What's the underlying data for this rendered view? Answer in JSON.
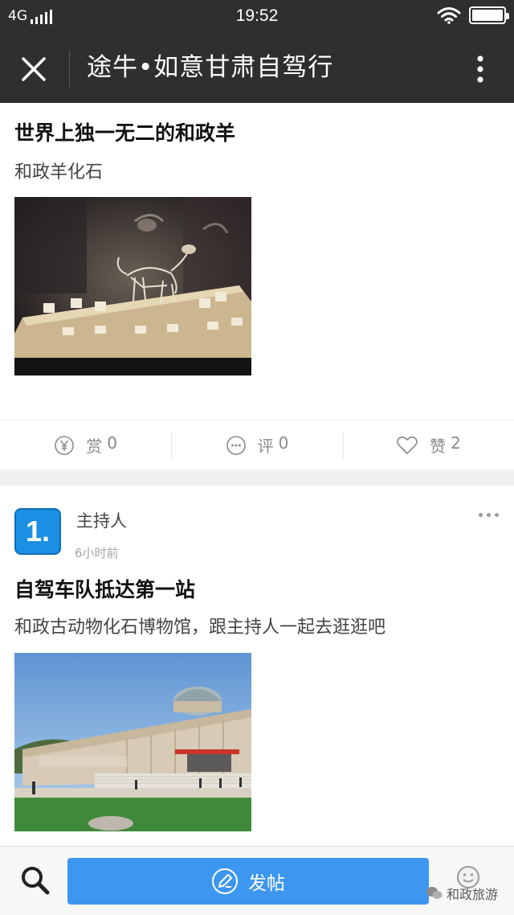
{
  "status_bar": {
    "network": "4G",
    "time": "19:52",
    "battery_level": 1.0
  },
  "nav": {
    "title": "途牛•如意甘肃自驾行",
    "close_icon": "close-icon",
    "more_icon": "more-vertical-icon"
  },
  "posts": [
    {
      "title": "世界上独一无二的和政羊",
      "description": "和政羊化石",
      "image": "fossil-sheep-skeleton-photo",
      "actions": {
        "reward": {
          "label": "赏",
          "count": "0"
        },
        "comment": {
          "label": "评",
          "count": "0"
        },
        "like": {
          "label": "赞",
          "count": "2"
        }
      }
    },
    {
      "author": "主持人",
      "avatar_text": "1.",
      "time": "6小时前",
      "title": "自驾车队抵达第一站",
      "description": "和政古动物化石博物馆，跟主持人一起去逛逛吧",
      "image": "museum-building-photo"
    }
  ],
  "bottom_bar": {
    "post_button": "发帖",
    "watermark": "和政旅游"
  },
  "colors": {
    "header_bg": "#2f2f31",
    "accent": "#3d96f0",
    "avatar_bg": "#1a8fe3"
  }
}
